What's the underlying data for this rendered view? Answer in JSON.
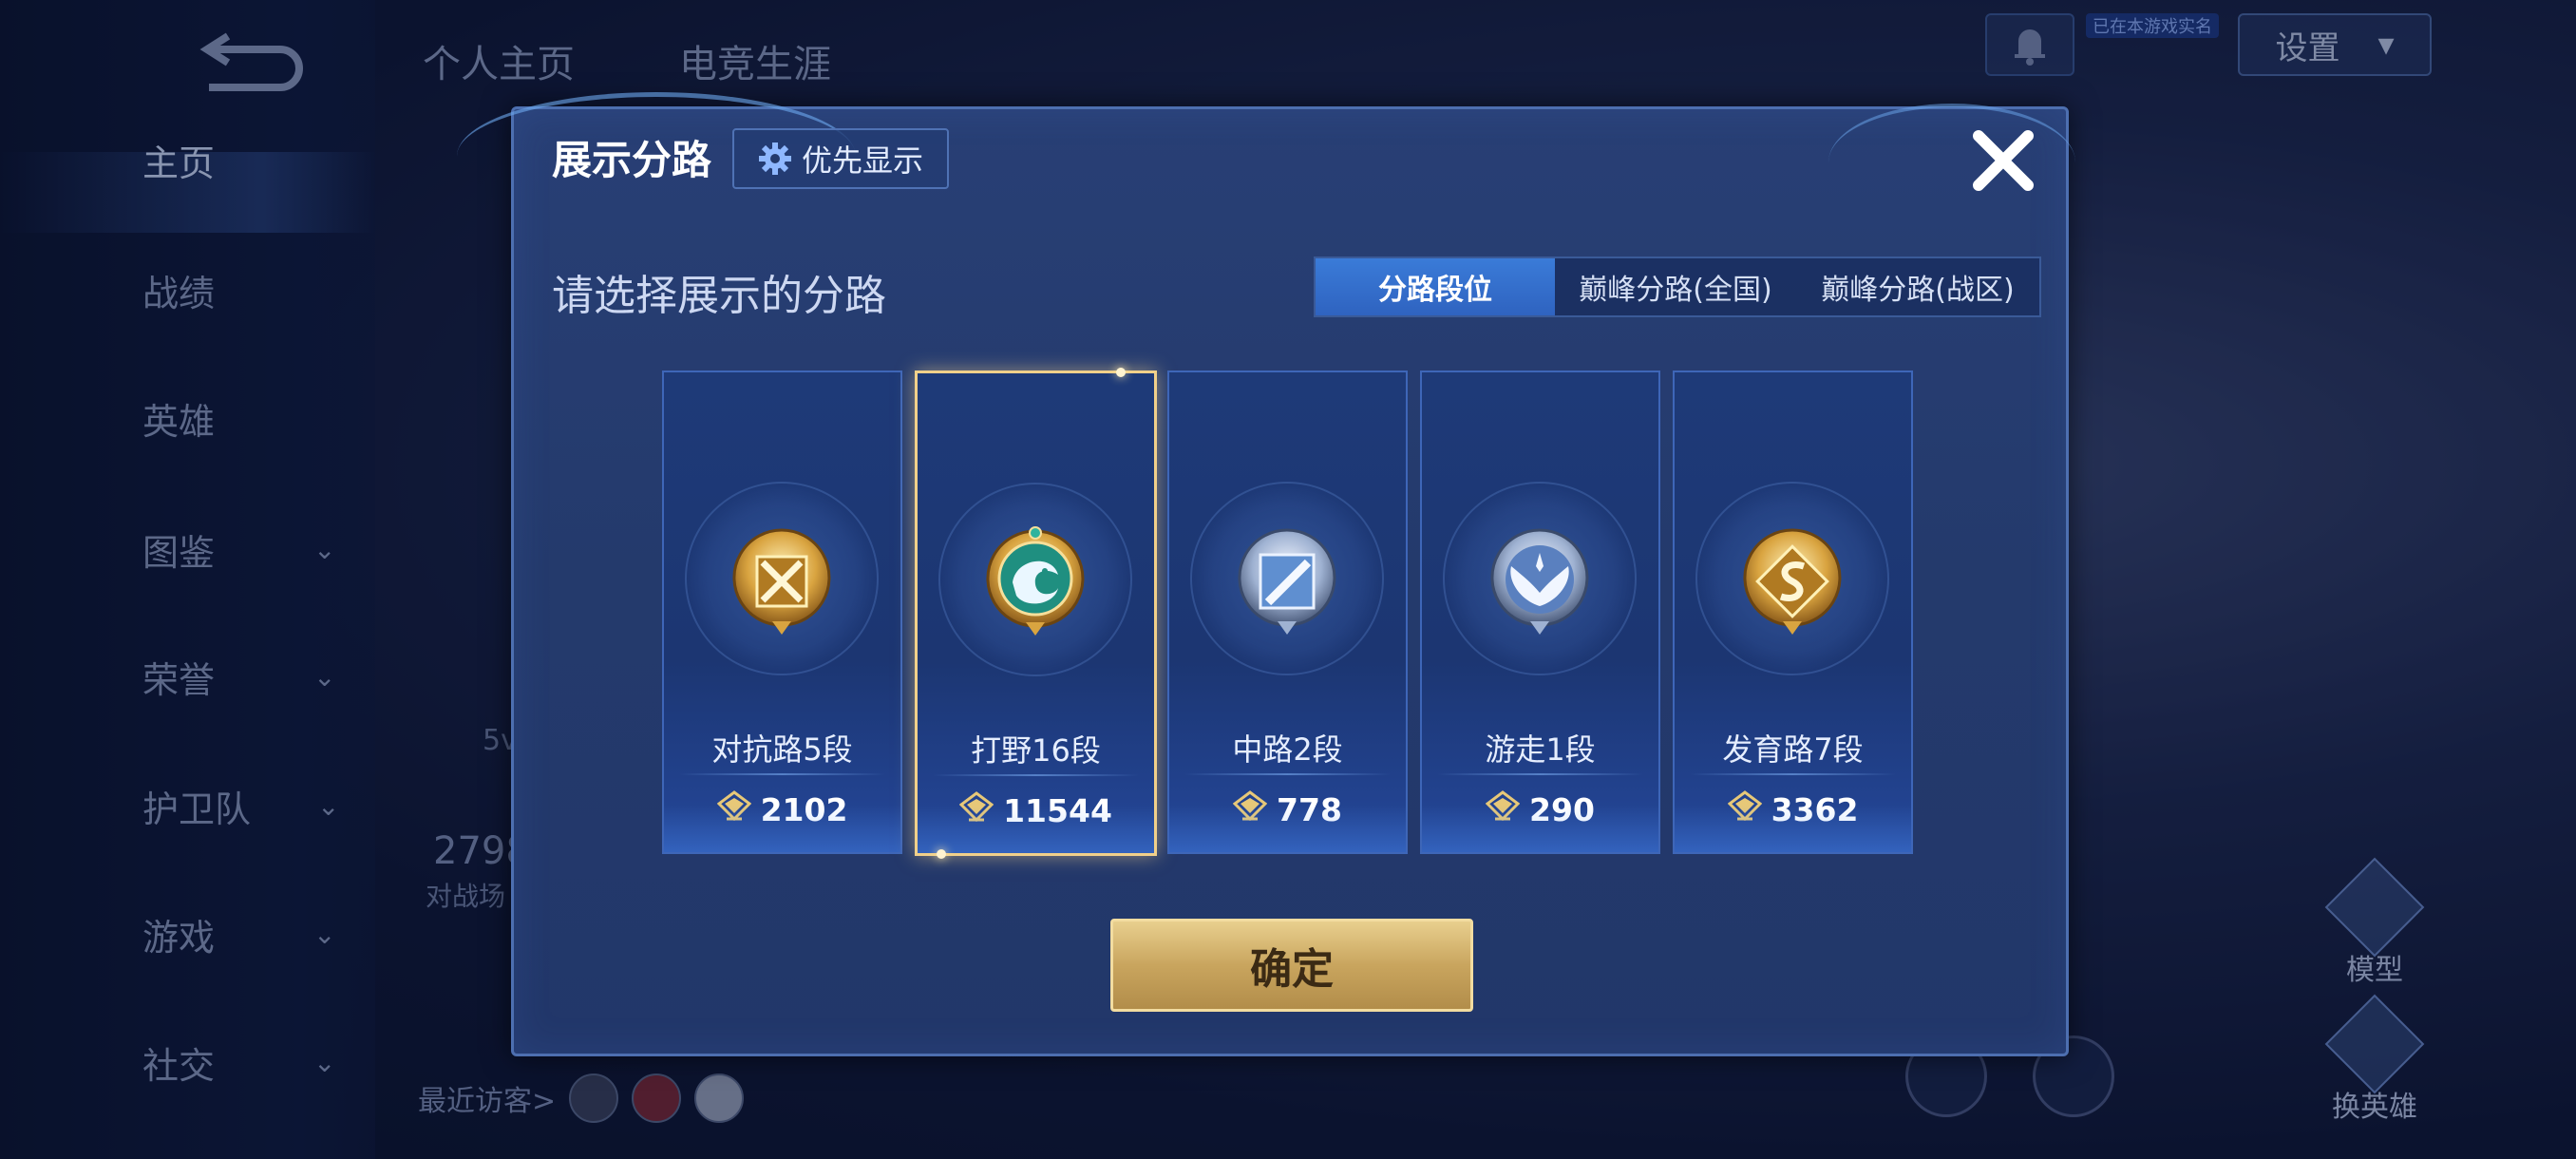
{
  "background": {
    "nav": {
      "items": [
        {
          "label": "主页",
          "has_chevron": false,
          "active": true
        },
        {
          "label": "战绩",
          "has_chevron": false
        },
        {
          "label": "英雄",
          "has_chevron": false
        },
        {
          "label": "图鉴",
          "has_chevron": true
        },
        {
          "label": "荣誉",
          "has_chevron": true
        },
        {
          "label": "护卫队",
          "has_chevron": true
        },
        {
          "label": "游戏",
          "has_chevron": true
        },
        {
          "label": "社交",
          "has_chevron": true
        }
      ]
    },
    "top_tabs": [
      "个人主页",
      "电竞生涯"
    ],
    "settings_label": "设置",
    "badge_text": "已在本游戏实名",
    "right_buttons": [
      "模型",
      "换英雄"
    ],
    "recent_visitors_label": "最近访客>",
    "partial_stat": "2798",
    "partial_stat_sub": "对战场",
    "partial_5v": "5v"
  },
  "dialog": {
    "title": "展示分路",
    "priority_button_label": "优先显示",
    "subtitle": "请选择展示的分路",
    "tabs": [
      {
        "label": "分路段位",
        "selected": true
      },
      {
        "label": "巅峰分路(全国)",
        "selected": false
      },
      {
        "label": "巅峰分路(战区)",
        "selected": false
      }
    ],
    "lanes": [
      {
        "label": "对抗路5段",
        "score": "2102",
        "emblem": "crossed-swords-emblem",
        "selected": false
      },
      {
        "label": "打野16段",
        "score": "11544",
        "emblem": "dragon-emblem",
        "selected": true
      },
      {
        "label": "中路2段",
        "score": "778",
        "emblem": "mid-slash-emblem",
        "selected": false
      },
      {
        "label": "游走1段",
        "score": "290",
        "emblem": "wings-emblem",
        "selected": false
      },
      {
        "label": "发育路7段",
        "score": "3362",
        "emblem": "s-curve-emblem",
        "selected": false
      }
    ],
    "confirm_label": "确定"
  },
  "colors": {
    "selected_tab": "#3a7bd8",
    "selected_card_border": "#f1d08a",
    "confirm_gold": "#c9a55e"
  }
}
